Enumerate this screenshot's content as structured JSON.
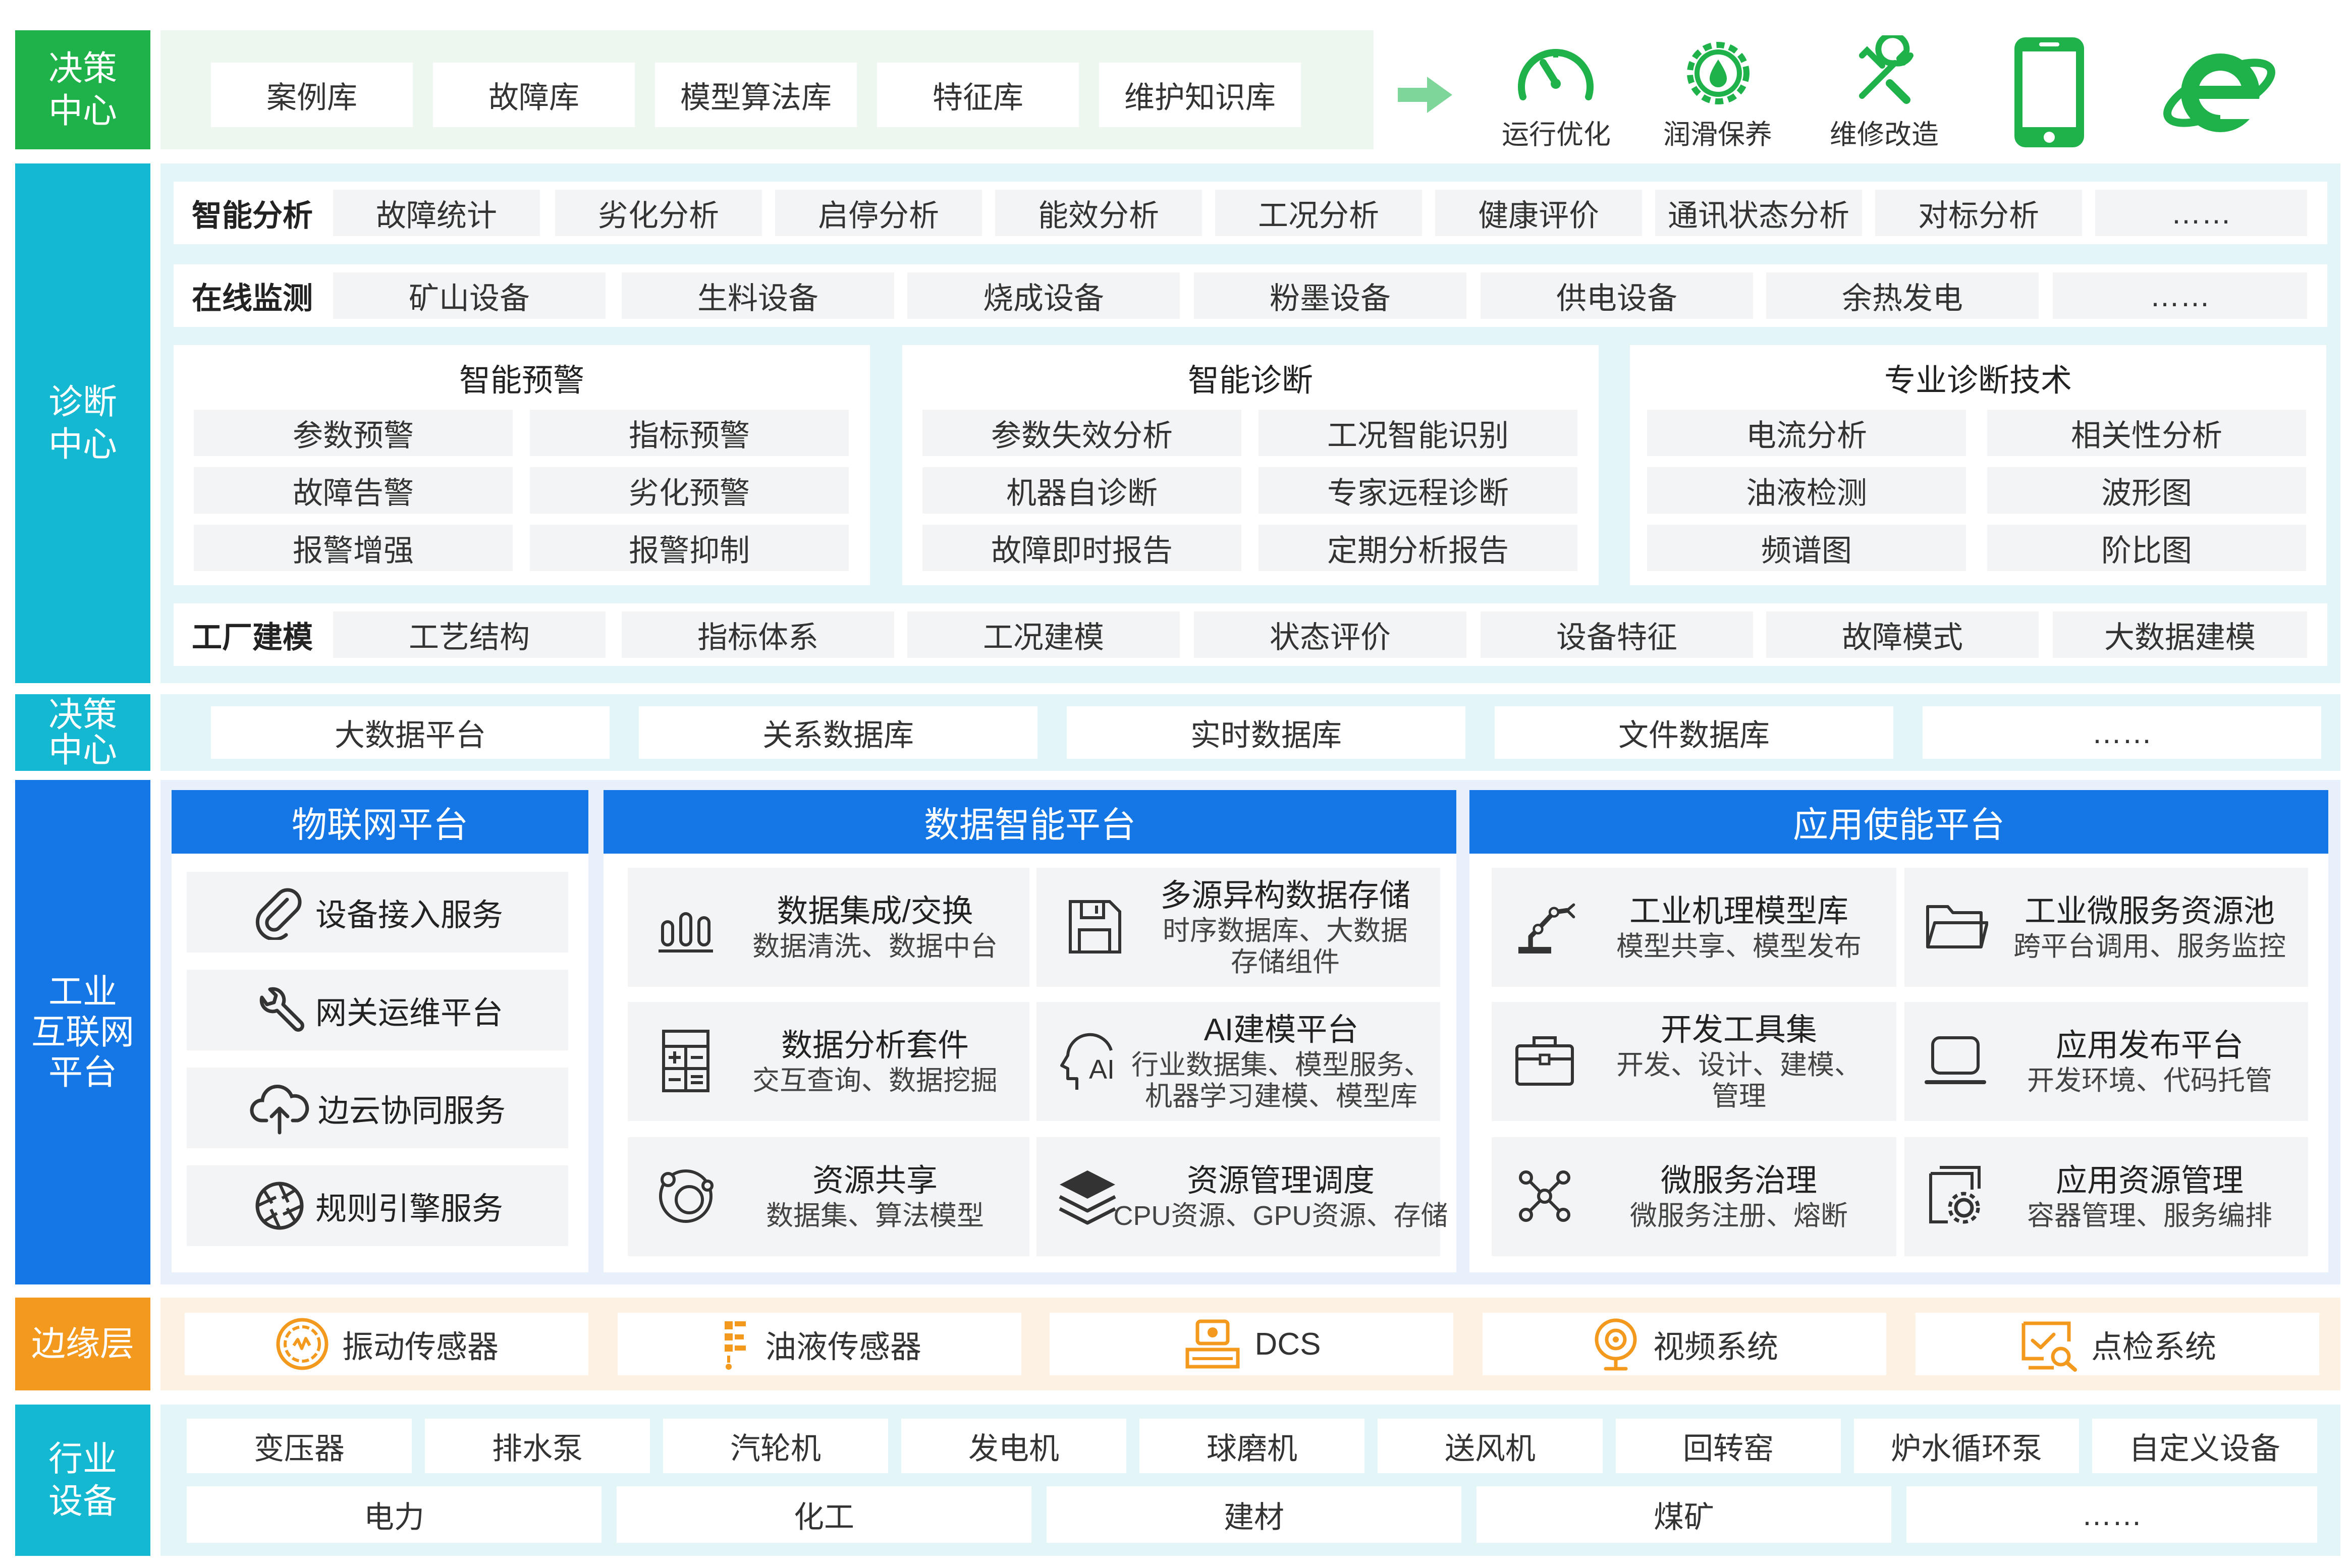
{
  "colors": {
    "green": "#1fb24a",
    "teal": "#14b8d0",
    "blue": "#1577e6",
    "orange": "#f39a1e",
    "light_green_bg": "#edf7ef",
    "light_teal_bg": "#e4f5f8",
    "light_blue_bg": "#e8f1fb",
    "light_orange_bg": "#fdf1e3"
  },
  "decision_top": {
    "label": [
      "决策",
      "中心"
    ],
    "items": [
      "案例库",
      "故障库",
      "模型算法库",
      "特征库",
      "维护知识库"
    ],
    "outputs": [
      {
        "label": "运行优化",
        "icon": "speedometer-icon"
      },
      {
        "label": "润滑保养",
        "icon": "gear-drop-icon"
      },
      {
        "label": "维修改造",
        "icon": "wrench-icon"
      }
    ],
    "devices": [
      {
        "icon": "phone-icon"
      },
      {
        "icon": "browser-e-icon"
      }
    ]
  },
  "diagnosis": {
    "label": [
      "诊断",
      "中心"
    ],
    "smart_analysis": {
      "title": "智能分析",
      "items": [
        "故障统计",
        "劣化分析",
        "启停分析",
        "能效分析",
        "工况分析",
        "健康评价",
        "通讯状态分析",
        "对标分析",
        "……"
      ]
    },
    "online_monitor": {
      "title": "在线监测",
      "items": [
        "矿山设备",
        "生料设备",
        "烧成设备",
        "粉墨设备",
        "供电设备",
        "余热发电",
        "……"
      ]
    },
    "warning": {
      "title": "智能预警",
      "items": [
        "参数预警",
        "指标预警",
        "故障告警",
        "劣化预警",
        "报警增强",
        "报警抑制"
      ]
    },
    "smart_diag": {
      "title": "智能诊断",
      "items": [
        "参数失效分析",
        "工况智能识别",
        "机器自诊断",
        "专家远程诊断",
        "故障即时报告",
        "定期分析报告"
      ]
    },
    "pro_diag": {
      "title": "专业诊断技术",
      "items": [
        "电流分析",
        "相关性分析",
        "油液检测",
        "波形图",
        "频谱图",
        "阶比图"
      ]
    },
    "factory_model": {
      "title": "工厂建模",
      "items": [
        "工艺结构",
        "指标体系",
        "工况建模",
        "状态评价",
        "设备特征",
        "故障模式",
        "大数据建模"
      ]
    }
  },
  "data_layer": {
    "label": [
      "决策",
      "中心"
    ],
    "items": [
      "大数据平台",
      "关系数据库",
      "实时数据库",
      "文件数据库",
      "……"
    ]
  },
  "platform": {
    "label": [
      "工业",
      "互联网",
      "平台"
    ],
    "iot": {
      "title": "物联网平台",
      "items": [
        {
          "label": "设备接入服务",
          "icon": "paperclip-icon"
        },
        {
          "label": "网关运维平台",
          "icon": "wrench-icon"
        },
        {
          "label": "边云协同服务",
          "icon": "cloud-upload-icon"
        },
        {
          "label": "规则引擎服务",
          "icon": "aperture-icon"
        }
      ]
    },
    "data_intel": {
      "title": "数据智能平台",
      "cards": [
        {
          "title": "数据集成/交换",
          "desc": [
            "数据清洗、数据中台"
          ],
          "icon": "bar-chart-icon"
        },
        {
          "title": "多源异构数据存储",
          "desc": [
            "时序数据库、大数据",
            "存储组件"
          ],
          "icon": "floppy-disk-icon"
        },
        {
          "title": "数据分析套件",
          "desc": [
            "交互查询、数据挖掘"
          ],
          "icon": "calculator-icon"
        },
        {
          "title": "AI建模平台",
          "desc": [
            "行业数据集、模型服务、",
            "机器学习建模、模型库"
          ],
          "icon": "ai-head-icon"
        },
        {
          "title": "资源共享",
          "desc": [
            "数据集、算法模型"
          ],
          "icon": "orbit-icon"
        },
        {
          "title": "资源管理调度",
          "desc": [
            "CPU资源、GPU资源、存储"
          ],
          "icon": "layers-icon"
        }
      ]
    },
    "app_enable": {
      "title": "应用使能平台",
      "cards": [
        {
          "title": "工业机理模型库",
          "desc": [
            "模型共享、模型发布"
          ],
          "icon": "robot-arm-icon"
        },
        {
          "title": "工业微服务资源池",
          "desc": [
            "跨平台调用、服务监控"
          ],
          "icon": "folder-icon"
        },
        {
          "title": "开发工具集",
          "desc": [
            "开发、设计、建模、",
            "管理"
          ],
          "icon": "briefcase-icon"
        },
        {
          "title": "应用发布平台",
          "desc": [
            "开发环境、代码托管"
          ],
          "icon": "laptop-icon"
        },
        {
          "title": "微服务治理",
          "desc": [
            "微服务注册、熔断"
          ],
          "icon": "network-nodes-icon"
        },
        {
          "title": "应用资源管理",
          "desc": [
            "容器管理、服务编排"
          ],
          "icon": "doc-gear-icon"
        }
      ]
    }
  },
  "edge": {
    "label": "边缘层",
    "items": [
      {
        "label": "振动传感器",
        "icon": "vibration-icon"
      },
      {
        "label": "油液传感器",
        "icon": "oil-sensor-icon"
      },
      {
        "label": "DCS",
        "icon": "dcs-icon"
      },
      {
        "label": "视频系统",
        "icon": "webcam-icon"
      },
      {
        "label": "点检系统",
        "icon": "inspection-icon"
      }
    ]
  },
  "industry": {
    "label": [
      "行业",
      "设备"
    ],
    "row1": [
      "变压器",
      "排水泵",
      "汽轮机",
      "发电机",
      "球磨机",
      "送风机",
      "回转窑",
      "炉水循环泵",
      "自定义设备"
    ],
    "row2": [
      "电力",
      "化工",
      "建材",
      "煤矿",
      "……"
    ]
  }
}
